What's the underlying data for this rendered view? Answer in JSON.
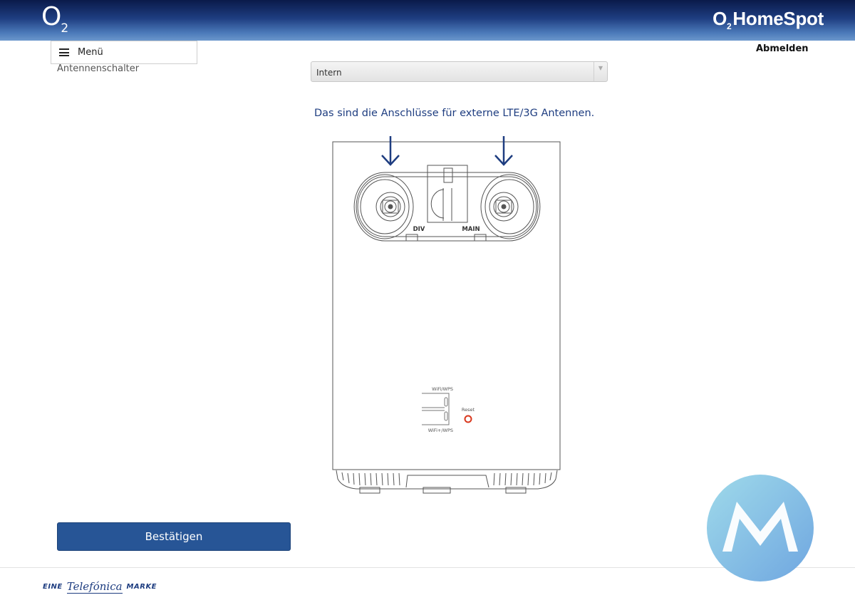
{
  "header": {
    "logo_o": "O",
    "logo_2": "2",
    "brand_o2": "O2",
    "brand_name": "HomeSpot"
  },
  "nav": {
    "menu_label": "Menü",
    "logout_label": "Abmelden"
  },
  "form": {
    "field_label": "Antennenschalter",
    "select_value": "Intern",
    "info_text": "Das sind die Anschlüsse für externe LTE/3G Antennen.",
    "confirm_label": "Bestätigen"
  },
  "router": {
    "port_left_label": "DIV",
    "port_right_label": "MAIN",
    "button_top_label": "WiFi/WPS",
    "button_bottom_label": "WiFi+/WPS",
    "reset_label": "Reset"
  },
  "footer": {
    "prefix": "EINE",
    "brand": "Telefónica",
    "suffix": "MARKE"
  },
  "colors": {
    "header_dark": "#0a1a4a",
    "header_light": "#6b97cc",
    "accent_blue": "#1e3d80",
    "button_blue": "#275596",
    "reset_red": "#d9381e",
    "watermark": "#7fc6e6"
  }
}
